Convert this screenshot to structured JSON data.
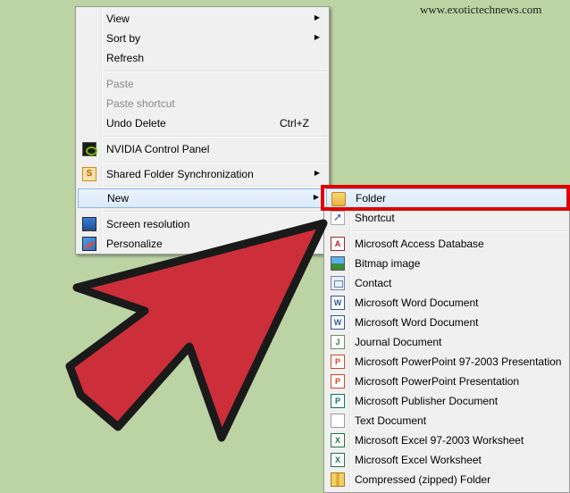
{
  "watermark": "www.exotictechnews.com",
  "context_menu": {
    "view": "View",
    "sort_by": "Sort by",
    "refresh": "Refresh",
    "paste": "Paste",
    "paste_shortcut": "Paste shortcut",
    "undo_delete": "Undo Delete",
    "undo_delete_shortcut": "Ctrl+Z",
    "nvidia": "NVIDIA Control Panel",
    "shared_folder_sync": "Shared Folder Synchronization",
    "new": "New",
    "screen_resolution": "Screen resolution",
    "personalize": "Personalize"
  },
  "new_submenu": {
    "items": [
      {
        "label": "Folder",
        "icon": "folder-icon"
      },
      {
        "label": "Shortcut",
        "icon": "shortcut-icon"
      },
      {
        "label": "Microsoft Access Database",
        "icon": "access-icon"
      },
      {
        "label": "Bitmap image",
        "icon": "bitmap-icon"
      },
      {
        "label": "Contact",
        "icon": "contact-icon"
      },
      {
        "label": "Microsoft Word Document",
        "icon": "word-icon"
      },
      {
        "label": "Microsoft Word Document",
        "icon": "word-icon"
      },
      {
        "label": "Journal Document",
        "icon": "journal-icon"
      },
      {
        "label": "Microsoft PowerPoint 97-2003 Presentation",
        "icon": "powerpoint-icon"
      },
      {
        "label": "Microsoft PowerPoint Presentation",
        "icon": "powerpoint-icon"
      },
      {
        "label": "Microsoft Publisher Document",
        "icon": "publisher-icon"
      },
      {
        "label": "Text Document",
        "icon": "text-document-icon"
      },
      {
        "label": "Microsoft Excel 97-2003 Worksheet",
        "icon": "excel-icon"
      },
      {
        "label": "Microsoft Excel Worksheet",
        "icon": "excel-icon"
      },
      {
        "label": "Compressed (zipped) Folder",
        "icon": "zip-folder-icon"
      }
    ]
  },
  "colors": {
    "desktop_background": "#bcd3a4",
    "highlight_box": "#e00000",
    "arrow_fill": "#cc2f3a"
  }
}
